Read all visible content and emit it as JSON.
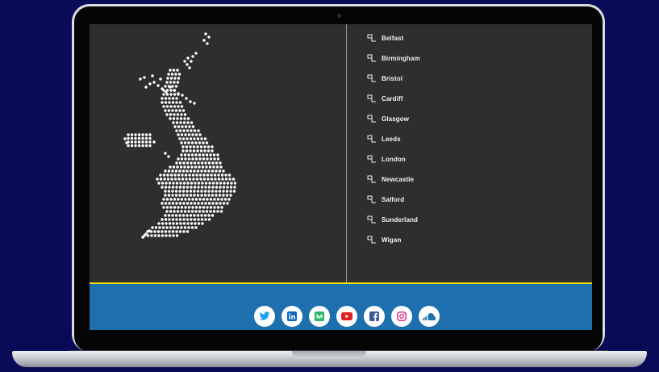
{
  "cities": [
    {
      "label": "Belfast"
    },
    {
      "label": "Birmingham"
    },
    {
      "label": "Bristol"
    },
    {
      "label": "Cardiff"
    },
    {
      "label": "Glasgow"
    },
    {
      "label": "Leeds"
    },
    {
      "label": "London"
    },
    {
      "label": "Newcastle"
    },
    {
      "label": "Salford"
    },
    {
      "label": "Sunderland"
    },
    {
      "label": "Wigan"
    }
  ],
  "social_links": [
    {
      "name": "twitter",
      "icon": "twitter-icon",
      "color": "#1da1f2"
    },
    {
      "name": "linkedin",
      "icon": "linkedin-icon",
      "color": "#0a66c2"
    },
    {
      "name": "medium",
      "icon": "medium-icon",
      "color": "#2ab56b"
    },
    {
      "name": "youtube",
      "icon": "youtube-icon",
      "color": "#e02020"
    },
    {
      "name": "facebook",
      "icon": "facebook-icon",
      "color": "#3b5998"
    },
    {
      "name": "instagram",
      "icon": "instagram-icon",
      "color": "#d6287a"
    },
    {
      "name": "soundcloud",
      "icon": "soundcloud-icon",
      "color": "#1d6fae"
    }
  ],
  "colors": {
    "page_background": "#0a0b57",
    "screen_background": "#2e2e2e",
    "footer_background": "#1d6fae",
    "footer_accent": "#f1e10f",
    "map_dots": "#ffffff"
  }
}
